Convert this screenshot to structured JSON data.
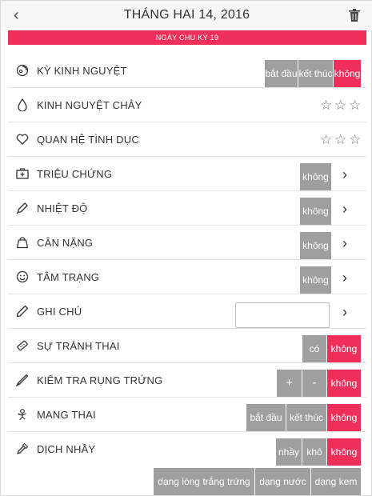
{
  "header": {
    "back_icon": "chevron-left-icon",
    "back_glyph": "‹",
    "title": "THÁNG HAI 14, 2016",
    "delete_icon": "trash-icon"
  },
  "cycle_day": "NGÀY CHU KỲ 19",
  "rows": {
    "period": {
      "label": "KỲ KINH NGUYỆT",
      "icon": "period-icon",
      "options": [
        "bắt đầu",
        "kết thúc",
        "không"
      ],
      "selected": "không"
    },
    "flow": {
      "label": "KINH NGUYỆT CHẢY",
      "icon": "drop-icon",
      "rating": 0,
      "rating_max": 3
    },
    "intimacy": {
      "label": "QUAN HỆ TÌNH DỤC",
      "icon": "heart-icon",
      "rating": 0,
      "rating_max": 3
    },
    "symptoms": {
      "label": "TRIỆU CHỨNG",
      "icon": "medical-kit-icon",
      "value": "không"
    },
    "temperature": {
      "label": "NHIỆT ĐỘ",
      "icon": "thermometer-icon",
      "value": "không"
    },
    "weight": {
      "label": "CÂN NẶNG",
      "icon": "weight-icon",
      "value": "không"
    },
    "mood": {
      "label": "TÂM TRẠNG",
      "icon": "smiley-icon",
      "value": "không"
    },
    "notes": {
      "label": "GHI CHÚ",
      "icon": "pencil-icon",
      "value": ""
    },
    "contraception": {
      "label": "SỰ TRÁNH THAI",
      "icon": "pill-pack-icon",
      "options": [
        "có",
        "không"
      ],
      "selected": "không"
    },
    "ovulation": {
      "label": "KIỂM TRA RỤNG TRỨNG",
      "icon": "test-stick-icon",
      "options": [
        "+",
        "-",
        "không"
      ],
      "selected": "không"
    },
    "pregnancy": {
      "label": "MANG THAI",
      "icon": "baby-icon",
      "options": [
        "bắt đầu",
        "kết thúc",
        "không"
      ],
      "selected": "không"
    },
    "discharge": {
      "label": "DỊCH NHẦY",
      "icon": "dropper-icon",
      "options": [
        "nhầy",
        "khô",
        "không"
      ],
      "selected": "không",
      "extra_options": [
        "dạng lòng trắng trứng",
        "dạng nước",
        "dạng kem"
      ]
    }
  },
  "chevron_glyph": "›",
  "star_glyph": "☆",
  "colors": {
    "accent": "#ef2f5a",
    "inactive": "#9f9f9f"
  }
}
